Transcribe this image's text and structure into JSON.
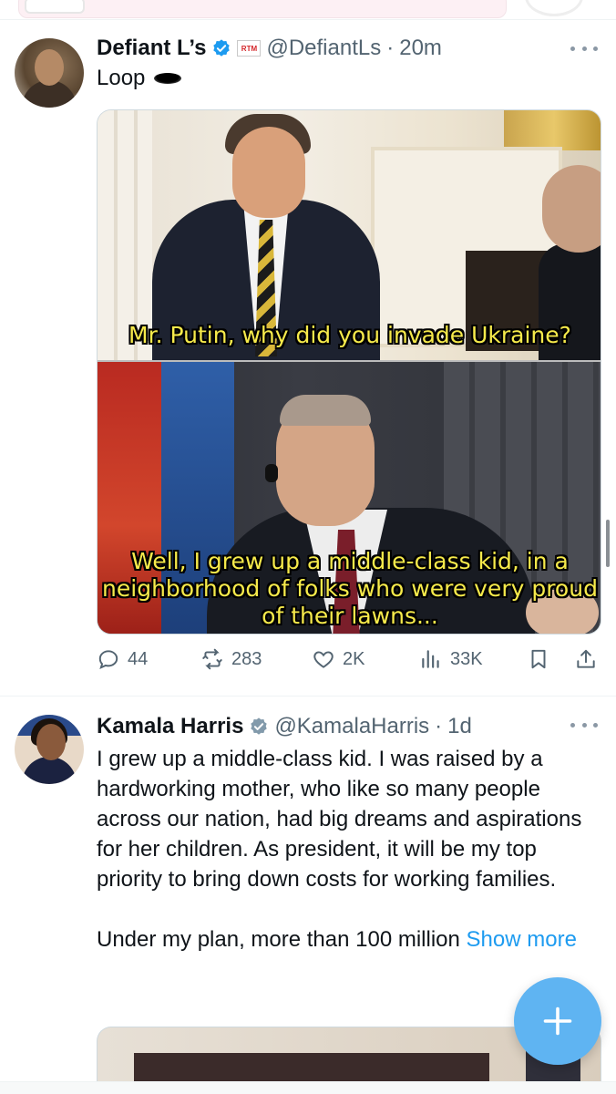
{
  "tweets": [
    {
      "name": "Defiant L’s",
      "badge": "RTM",
      "handle": "@DefiantLs",
      "sep": "·",
      "time": "20m",
      "text": "Loop",
      "image_captions": {
        "top": "Mr. Putin, why did you invade Ukraine?",
        "bottom": "Well, I grew up a middle-class kid, in a neighborhood of folks who were very proud of their lawns..."
      },
      "stats": {
        "replies": "44",
        "reposts": "283",
        "likes": "2K",
        "views": "33K"
      }
    },
    {
      "name": "Kamala Harris",
      "handle": "@KamalaHarris",
      "sep": "·",
      "time": "1d",
      "paragraph1": "I grew up a middle-class kid. I was raised by a hardworking mother, who like so many people across our nation, had big dreams and aspirations for her children. As president, it will be my top priority to bring down costs for working families.",
      "paragraph2": "Under my plan, more than 100 million ",
      "show_more": "Show more"
    }
  ],
  "colors": {
    "accent": "#1d9bf0",
    "secondary_text": "#536471",
    "verified_blue": "#1d9bf0",
    "verified_gray": "#829aab",
    "caption_yellow": "#f6ea4b",
    "fab": "#5fb4f2"
  },
  "icons": [
    "verified-badge-icon",
    "more-icon",
    "reply-icon",
    "repost-icon",
    "like-icon",
    "views-icon",
    "bookmark-icon",
    "share-icon",
    "compose-plus-icon"
  ]
}
